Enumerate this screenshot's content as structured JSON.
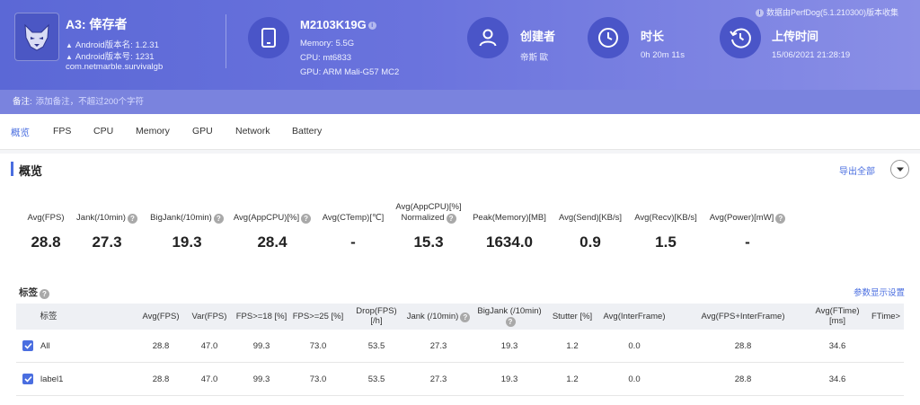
{
  "header": {
    "app_title": "A3: 倖存者",
    "version_name": "Android版本名: 1.2.31",
    "version_code": "Android版本号: 1231",
    "package": "com.netmarble.survivalgb",
    "device_model": "M2103K19G",
    "memory": "Memory: 5.5G",
    "cpu": "CPU: mt6833",
    "gpu": "GPU: ARM Mali-G57 MC2",
    "creator_title": "创建者",
    "creator_value": "帝斯 歐",
    "duration_title": "时长",
    "duration_value": "0h 20m 11s",
    "upload_title": "上传时间",
    "upload_value": "15/06/2021 21:28:19",
    "source_note": "数据由PerfDog(5.1.210300)版本收集"
  },
  "remark": {
    "label": "备注:",
    "placeholder": "添加备注，不超过200个字符"
  },
  "tabs": [
    "概览",
    "FPS",
    "CPU",
    "Memory",
    "GPU",
    "Network",
    "Battery"
  ],
  "overview": {
    "title": "概览",
    "export_label": "导出全部"
  },
  "metrics": [
    {
      "label": "Avg(FPS)",
      "value": "28.8"
    },
    {
      "label": "Jank(/10min)",
      "value": "27.3"
    },
    {
      "label": "BigJank(/10min)",
      "value": "19.3"
    },
    {
      "label": "Avg(AppCPU)[%]",
      "value": "28.4"
    },
    {
      "label": "Avg(CTemp)[℃]",
      "value": "-"
    },
    {
      "label": "Avg(AppCPU)[%]",
      "label2": "Normalized",
      "value": "15.3"
    },
    {
      "label": "Peak(Memory)[MB]",
      "value": "1634.0"
    },
    {
      "label": "Avg(Send)[KB/s]",
      "value": "0.9"
    },
    {
      "label": "Avg(Recv)[KB/s]",
      "value": "1.5"
    },
    {
      "label": "Avg(Power)[mW]",
      "value": "-"
    }
  ],
  "labels_section": {
    "title": "标签",
    "param_settings": "参数显示设置"
  },
  "table": {
    "headers": [
      {
        "l1": "标签",
        "l2": ""
      },
      {
        "l1": "Avg(FPS)",
        "l2": ""
      },
      {
        "l1": "Var(FPS)",
        "l2": ""
      },
      {
        "l1": "FPS>=18 [%]",
        "l2": ""
      },
      {
        "l1": "FPS>=25 [%]",
        "l2": ""
      },
      {
        "l1": "Drop(FPS)",
        "l2": "[/h]"
      },
      {
        "l1": "Jank (/10min)",
        "l2": ""
      },
      {
        "l1": "BigJank (/10min)",
        "l2": ""
      },
      {
        "l1": "Stutter [%]",
        "l2": ""
      },
      {
        "l1": "Avg(InterFrame)",
        "l2": ""
      },
      {
        "l1": "Avg(FPS+InterFrame)",
        "l2": ""
      },
      {
        "l1": "Avg(FTime)",
        "l2": "[ms]"
      },
      {
        "l1": "FTime>",
        "l2": ""
      }
    ],
    "rows": [
      {
        "name": "All",
        "cells": [
          "28.8",
          "47.0",
          "99.3",
          "73.0",
          "53.5",
          "27.3",
          "19.3",
          "1.2",
          "0.0",
          "28.8",
          "34.6"
        ]
      },
      {
        "name": "label1",
        "cells": [
          "28.8",
          "47.0",
          "99.3",
          "73.0",
          "53.5",
          "27.3",
          "19.3",
          "1.2",
          "0.0",
          "28.8",
          "34.6"
        ]
      }
    ]
  },
  "colors": {
    "header_start": "#5b68d6",
    "header_end": "#8a8fe6",
    "accent": "#4a6ee0"
  }
}
